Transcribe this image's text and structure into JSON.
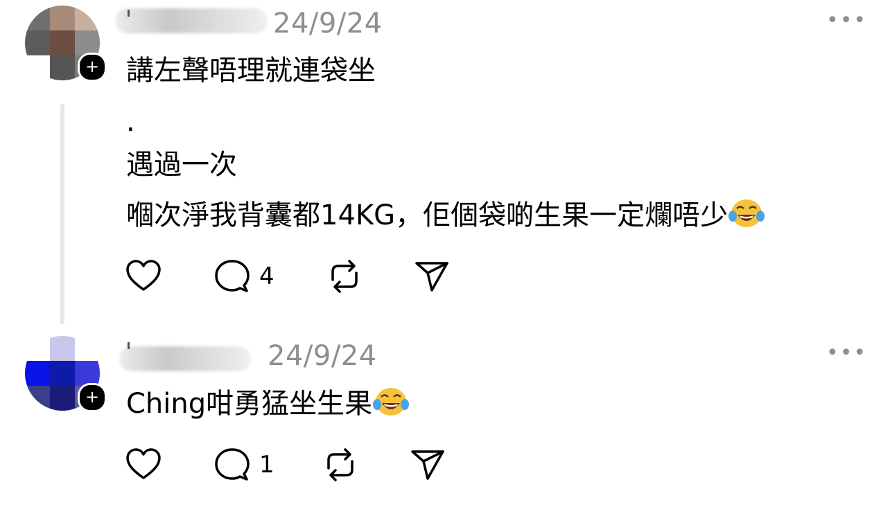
{
  "posts": [
    {
      "timestamp": "24/9/24",
      "more_label": "•••",
      "lines": [
        "講左聲唔理就連袋坐",
        ".",
        "遇過一次",
        "嗰次淨我背囊都14KG，佢個袋啲生果一定爛唔少"
      ],
      "emoji": "face-with-tears-of-joy",
      "actions": {
        "like_icon": "heart-icon",
        "reply_icon": "comment-icon",
        "reply_count": "4",
        "repost_icon": "repost-icon",
        "share_icon": "send-icon"
      }
    },
    {
      "timestamp": "24/9/24",
      "more_label": "•••",
      "lines": [
        "Ching咁勇猛坐生果"
      ],
      "emoji": "face-with-tears-of-joy",
      "actions": {
        "like_icon": "heart-icon",
        "reply_icon": "comment-icon",
        "reply_count": "1",
        "repost_icon": "repost-icon",
        "share_icon": "send-icon"
      }
    }
  ],
  "avatar_badge": "+",
  "colors": {
    "muted": "#8e8e8e",
    "thread_line": "#e6e6e6",
    "text": "#000000"
  }
}
